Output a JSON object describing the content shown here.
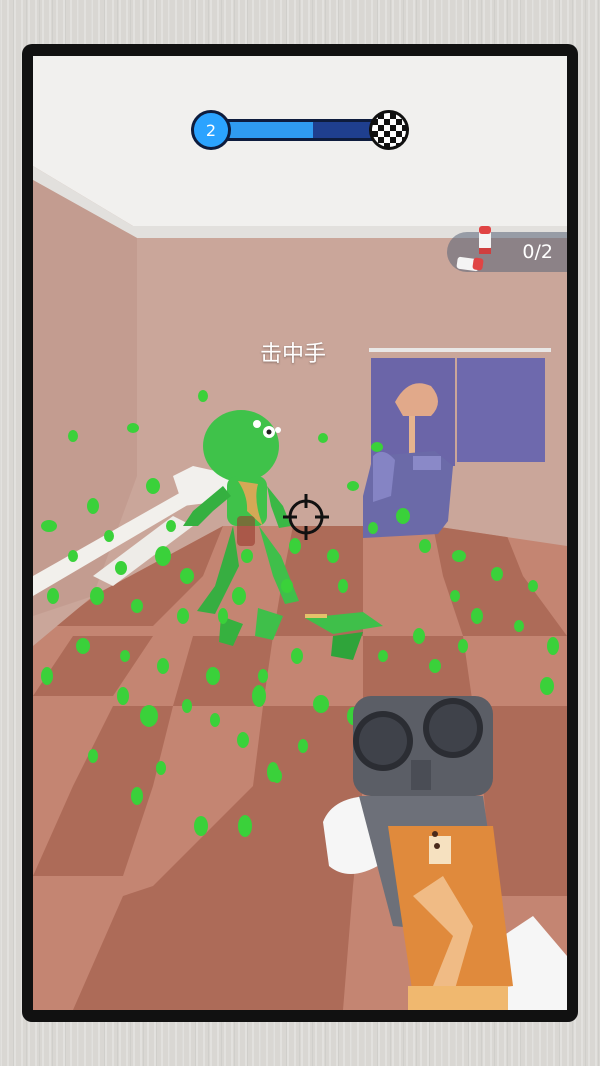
{
  "hud": {
    "level_number": "2",
    "level_progress": 0.58,
    "finish_icon": "checkered-flag",
    "ammo_count": "0/2",
    "ammo_icon": "shotgun-shells"
  },
  "feedback": {
    "hit_text": "击中手"
  },
  "colors": {
    "enemy": "#3fc24a",
    "splatter": "#3ad13a",
    "progress_fill": "#2f9bf0",
    "progress_track": "#1f3f8f",
    "floor_dark": "#b4705c",
    "floor_light": "#c98a77",
    "wall": "#caa69a",
    "curtain": "#6b65a8",
    "armchair": "#6b6aa8",
    "gun_stock": "#e08a3c",
    "gun_metal": "#5b5e66"
  }
}
